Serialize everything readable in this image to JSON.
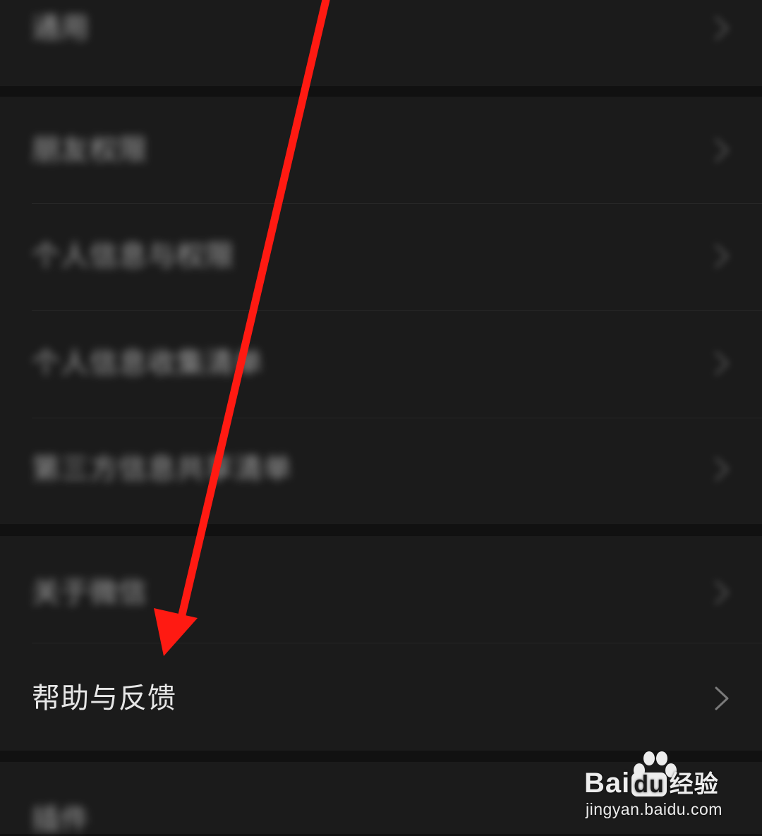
{
  "settings_list": {
    "items": [
      {
        "label": "通用",
        "blurred": true
      },
      {
        "label": "朋友权限",
        "blurred": true
      },
      {
        "label": "个人信息与权限",
        "blurred": true
      },
      {
        "label": "个人信息收集清单",
        "blurred": true
      },
      {
        "label": "第三方信息共享清单",
        "blurred": true
      },
      {
        "label": "关于微信",
        "blurred": true
      },
      {
        "label": "帮助与反馈",
        "blurred": false,
        "highlighted": true
      },
      {
        "label": "插件",
        "blurred": true
      }
    ]
  },
  "annotation": {
    "arrow_color": "#ff1a12",
    "points_to": "帮助与反馈"
  },
  "watermark": {
    "brand_left": "Bai",
    "brand_mid": "du",
    "brand_cn": "经验",
    "url": "jingyan.baidu.com"
  },
  "colors": {
    "background": "#111111",
    "row": "#1b1b1b",
    "text": "#e6e6e6",
    "chevron": "#7a7a7a"
  }
}
